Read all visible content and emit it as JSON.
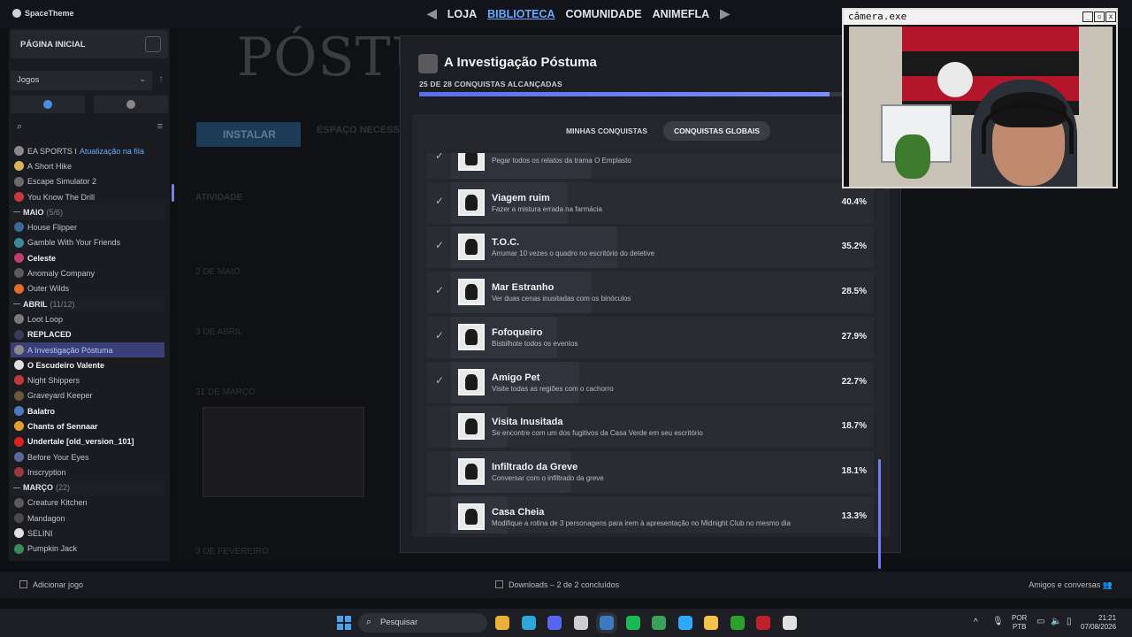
{
  "brand": "SpaceTheme",
  "nav": {
    "tabs": [
      "LOJA",
      "BIBLIOTECA",
      "COMUNIDADE",
      "ANIMEFLA"
    ],
    "active": "BIBLIOTECA"
  },
  "sidebar": {
    "home": "PÁGINA INICIAL",
    "games_dropdown": "Jogos",
    "items": [
      {
        "type": "game",
        "label": "EA SPORTS I",
        "extra": "Atualização na fila",
        "color": "#8a8a8a"
      },
      {
        "type": "game",
        "label": "A Short Hike",
        "color": "#d9b25a"
      },
      {
        "type": "game",
        "label": "Escape Simulator 2",
        "color": "#6a6a6a"
      },
      {
        "type": "game",
        "label": "You Know The Drill",
        "color": "#c63a3a"
      },
      {
        "type": "section",
        "label": "MAIO",
        "count": "(5/6)"
      },
      {
        "type": "game",
        "label": "House Flipper",
        "color": "#3a6a9a"
      },
      {
        "type": "game",
        "label": "Gamble With Your Friends",
        "color": "#3a8a9a"
      },
      {
        "type": "game",
        "label": "Celeste",
        "bold": true,
        "color": "#c43c6a"
      },
      {
        "type": "game",
        "label": "Anomaly Company",
        "color": "#5a5a5a"
      },
      {
        "type": "game",
        "label": "Outer Wilds",
        "color": "#e26a2a"
      },
      {
        "type": "section",
        "label": "ABRIL",
        "count": "(11/12)"
      },
      {
        "type": "game",
        "label": "Loot Loop",
        "color": "#7a7a7a"
      },
      {
        "type": "game",
        "label": "REPLACED",
        "bold": true,
        "color": "#3a3a5a"
      },
      {
        "type": "game",
        "label": "A Investigação Póstuma",
        "selected": true,
        "color": "#8a8a8a"
      },
      {
        "type": "game",
        "label": "O Escudeiro Valente",
        "bold": true,
        "color": "#e0e0e0"
      },
      {
        "type": "game",
        "label": "Night Shippers",
        "color": "#c03a3a"
      },
      {
        "type": "game",
        "label": "Graveyard Keeper",
        "color": "#6a5a3a"
      },
      {
        "type": "game",
        "label": "Balatro",
        "bold": true,
        "color": "#4a7ac0"
      },
      {
        "type": "game",
        "label": "Chants of Sennaar",
        "bold": true,
        "color": "#e0a030"
      },
      {
        "type": "game",
        "label": "Undertale [old_version_101]",
        "bold": true,
        "color": "#e02020"
      },
      {
        "type": "game",
        "label": "Before Your Eyes",
        "color": "#5a6a9a"
      },
      {
        "type": "game",
        "label": "Inscryption",
        "color": "#9a3a3a"
      },
      {
        "type": "section",
        "label": "MARÇO",
        "count": "(22)"
      },
      {
        "type": "game",
        "label": "Creature Kitchen",
        "color": "#5a5a5a"
      },
      {
        "type": "game",
        "label": "Mandagon",
        "color": "#4a4a4a"
      },
      {
        "type": "game",
        "label": "SELINI",
        "color": "#e0e0e0"
      },
      {
        "type": "game",
        "label": "Pumpkin Jack",
        "color": "#3a8a5a"
      }
    ]
  },
  "background": {
    "hero_title": "PÓSTUMA",
    "install_label": "INSTALAR",
    "space_label": "ESPAÇO NECESSÁ",
    "activity_label": "ATIVIDADE",
    "dates": [
      "2 DE MAIO",
      "3 DE ABRIL",
      "31 DE MARÇO",
      "3 DE FEVEREIRO"
    ]
  },
  "modal": {
    "title": "A Investigação Póstuma",
    "progress_text": "25 DE 28 CONQUISTAS ALCANÇADAS",
    "progress_fraction": 0.893,
    "tabs": [
      "MINHAS CONQUISTAS",
      "CONQUISTAS GLOBAIS"
    ],
    "active_tab": "CONQUISTAS GLOBAIS",
    "achievements": [
      {
        "name": "",
        "desc": "Pegar todos os relatos da trama O Emplasto",
        "pct": "",
        "done": true
      },
      {
        "name": "Viagem ruim",
        "desc": "Fazer a mistura errada na farmácia",
        "pct": "40.4%",
        "done": true
      },
      {
        "name": "T.O.C.",
        "desc": "Arrumar 10 vezes o quadro no escritório do detetive",
        "pct": "35.2%",
        "done": true
      },
      {
        "name": "Mar Estranho",
        "desc": "Ver duas cenas inusitadas com os binóculos",
        "pct": "28.5%",
        "done": true
      },
      {
        "name": "Fofoqueiro",
        "desc": "Bisbilhote todos os eventos",
        "pct": "27.9%",
        "done": true
      },
      {
        "name": "Amigo Pet",
        "desc": "Visite todas as regiões com o cachorro",
        "pct": "22.7%",
        "done": true
      },
      {
        "name": "Visita Inusitada",
        "desc": "Se encontre com um dos fugitivos da Casa Verde em seu escritório",
        "pct": "18.7%",
        "done": false
      },
      {
        "name": "Infiltrado da Greve",
        "desc": "Conversar com o infiltrado da greve",
        "pct": "18.1%",
        "done": false
      },
      {
        "name": "Casa Cheia",
        "desc": "Modifique a rotina de 3 personagens para irem à apresentação no Midnight Club no mesmo dia",
        "pct": "13.3%",
        "done": false
      }
    ]
  },
  "camera": {
    "title": "câmera.exe",
    "controls": [
      "_",
      "▫",
      "x"
    ]
  },
  "bottombar": {
    "add_game": "Adicionar jogo",
    "downloads": "Downloads – 2 de 2 concluídos",
    "friends": "Amigos e conversas"
  },
  "taskbar": {
    "search_placeholder": "Pesquisar",
    "lang": "POR",
    "layout": "PTB",
    "time": "21:21",
    "date": "07/08/2026",
    "apps": [
      {
        "name": "chrome",
        "color": "#e8b23a"
      },
      {
        "name": "edge",
        "color": "#2fa6d9"
      },
      {
        "name": "discord",
        "color": "#5865f2"
      },
      {
        "name": "obs",
        "color": "#cfcfcf"
      },
      {
        "name": "steam",
        "color": "#3a7bbf"
      },
      {
        "name": "spotify",
        "color": "#1db954"
      },
      {
        "name": "app-green",
        "color": "#3aa05a"
      },
      {
        "name": "photoshop",
        "color": "#31a8ff"
      },
      {
        "name": "explorer",
        "color": "#f2c14e"
      },
      {
        "name": "xbox",
        "color": "#2ba02b"
      },
      {
        "name": "app-red",
        "color": "#c0202a"
      },
      {
        "name": "app-white",
        "color": "#e0e0e0"
      }
    ]
  }
}
